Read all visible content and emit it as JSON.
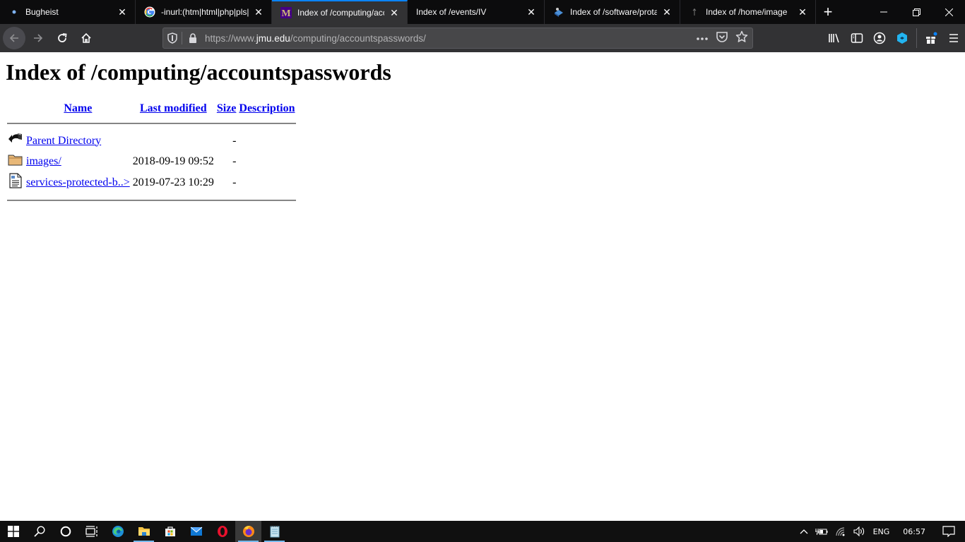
{
  "browser": {
    "tabs": [
      {
        "title": "Bugheist",
        "favicon": "dot-icon",
        "active": false
      },
      {
        "title": "-inurl:(htm|html|php|pls|",
        "favicon": "google-icon",
        "active": false
      },
      {
        "title": "Index of /computing/acc",
        "favicon": "jmu-m-icon",
        "active": true
      },
      {
        "title": "Index of /events/IV",
        "favicon": "none",
        "active": false
      },
      {
        "title": "Index of /software/protar",
        "favicon": "software-icon",
        "active": false
      },
      {
        "title": "Index of /home/image",
        "favicon": "small-icon",
        "active": false
      }
    ],
    "new_tab_label": "+",
    "url": {
      "scheme": "https://www.",
      "host": "jmu.edu",
      "path": "/computing/accountspasswords/"
    },
    "accent": "#0a84ff"
  },
  "page": {
    "heading": "Index of /computing/accountspasswords",
    "columns": {
      "name": "Name",
      "last_modified": "Last modified",
      "size": "Size",
      "description": "Description"
    },
    "rows": [
      {
        "icon": "back-arrow-icon",
        "name": "Parent Directory",
        "modified": "",
        "size": "-",
        "description": ""
      },
      {
        "icon": "folder-icon",
        "name": "images/",
        "modified": "2018-09-19 09:52",
        "size": "-",
        "description": ""
      },
      {
        "icon": "document-icon",
        "name": "services-protected-b..>",
        "modified": "2019-07-23 10:29",
        "size": "-",
        "description": ""
      }
    ]
  },
  "taskbar": {
    "apps": [
      "start",
      "search",
      "cortana",
      "task-view",
      "edge",
      "file-explorer",
      "store",
      "mail",
      "opera",
      "firefox",
      "notepad"
    ],
    "language": "ENG",
    "time": "06:57"
  }
}
